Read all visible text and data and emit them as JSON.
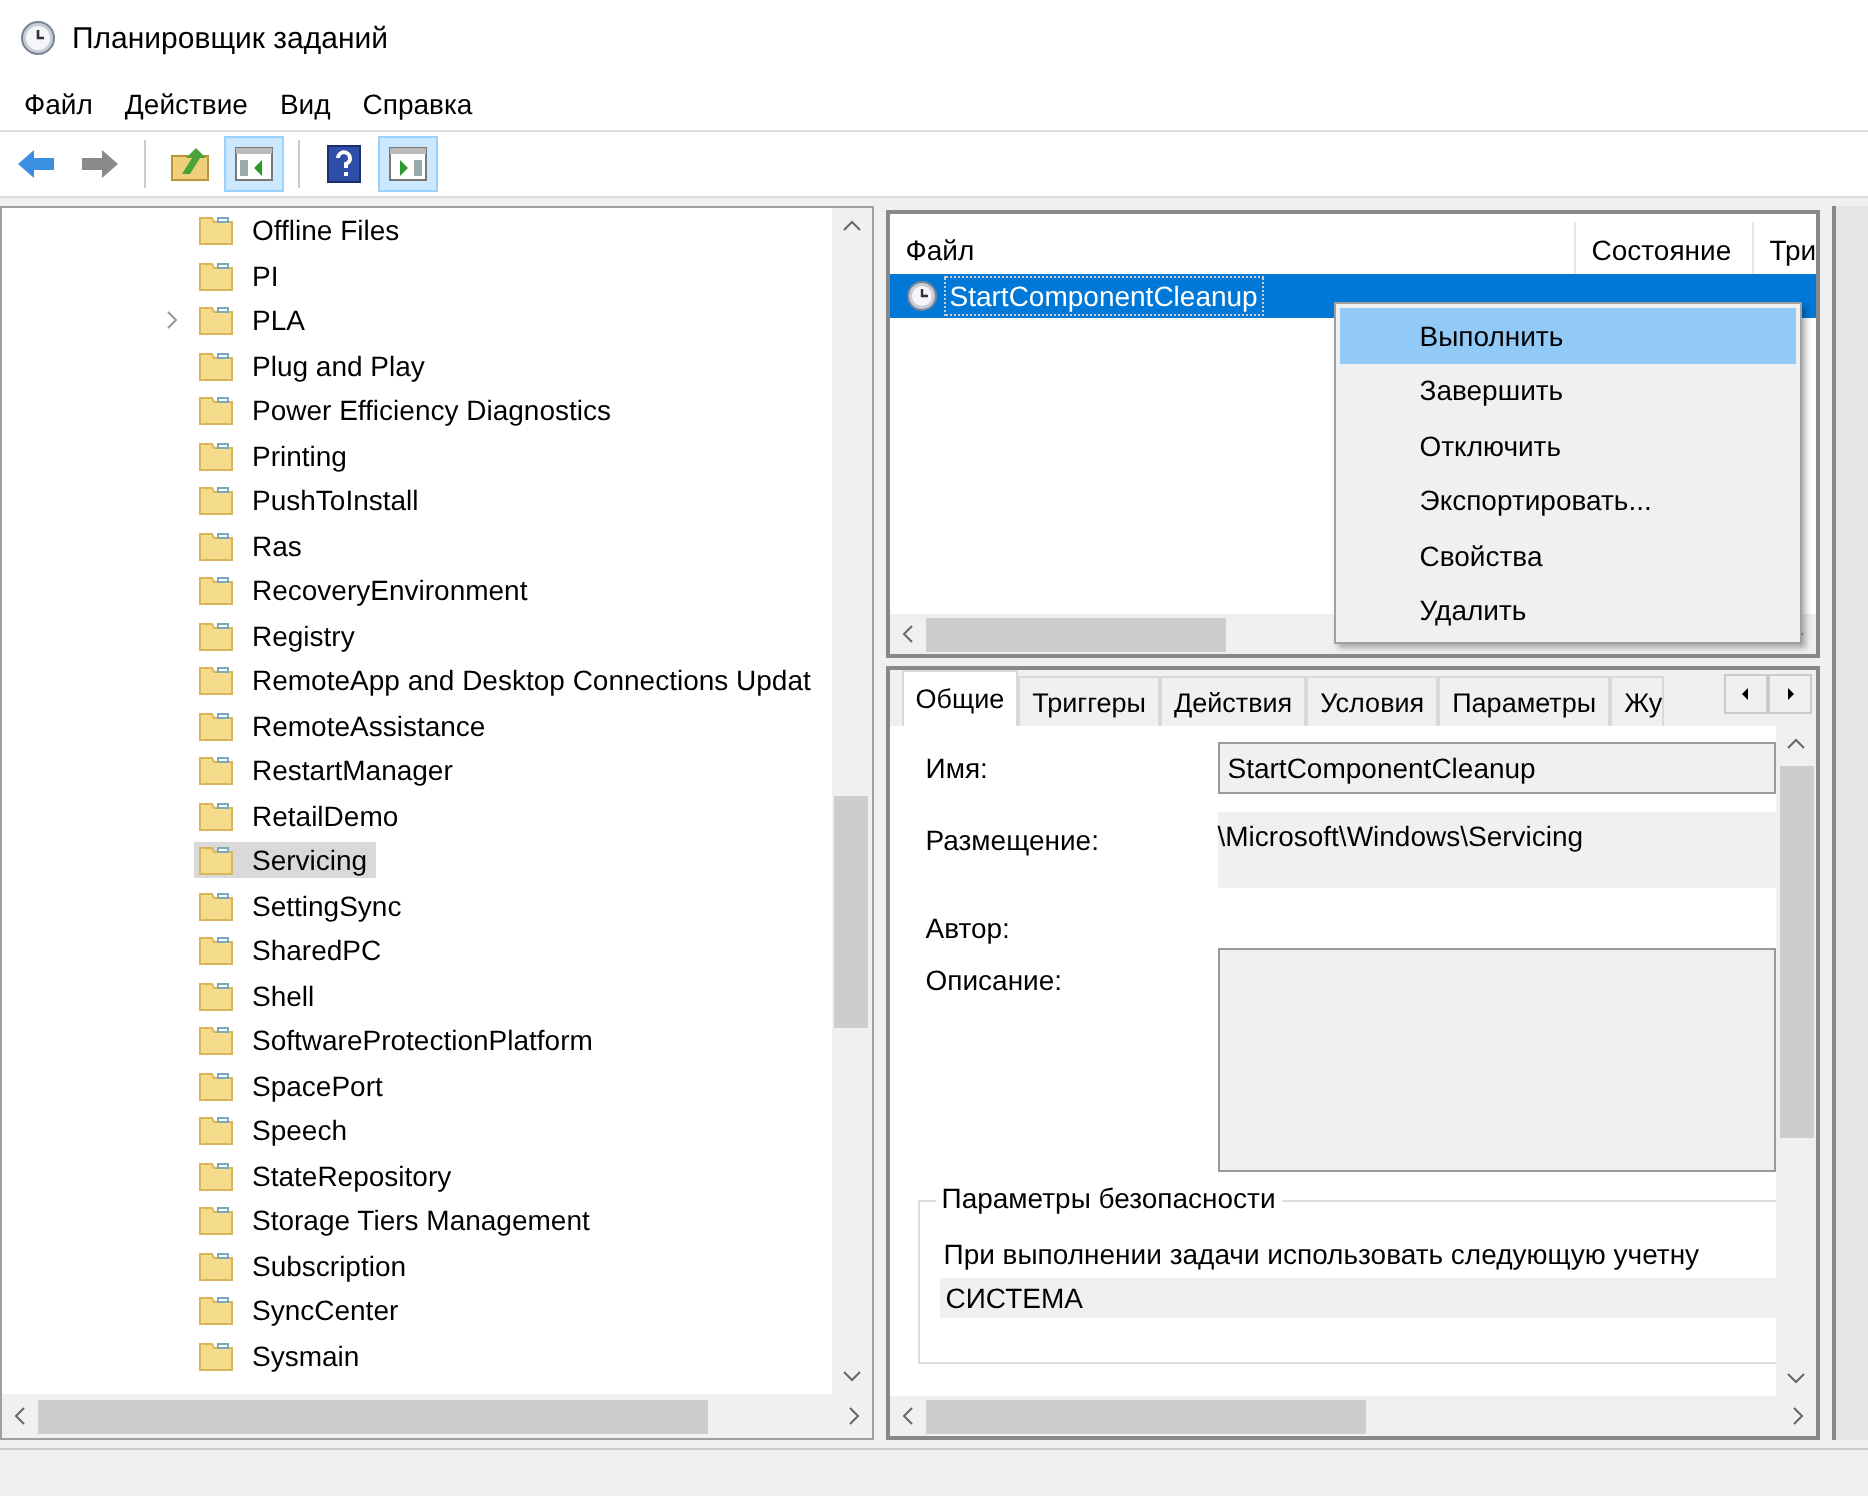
{
  "window": {
    "title": "Планировщик заданий"
  },
  "menu": [
    "Файл",
    "Действие",
    "Вид",
    "Справка"
  ],
  "toolbar": [
    {
      "kind": "back",
      "pressed": false
    },
    {
      "kind": "forward",
      "pressed": false
    },
    {
      "kind": "up",
      "pressed": false
    },
    {
      "kind": "tree",
      "pressed": true
    },
    {
      "kind": "help",
      "pressed": false
    },
    {
      "kind": "actions",
      "pressed": true
    }
  ],
  "tree": {
    "items": [
      {
        "label": "Offline Files",
        "expandable": false,
        "selected": false
      },
      {
        "label": "PI",
        "expandable": false,
        "selected": false
      },
      {
        "label": "PLA",
        "expandable": true,
        "selected": false
      },
      {
        "label": "Plug and Play",
        "expandable": false,
        "selected": false
      },
      {
        "label": "Power Efficiency Diagnostics",
        "expandable": false,
        "selected": false
      },
      {
        "label": "Printing",
        "expandable": false,
        "selected": false
      },
      {
        "label": "PushToInstall",
        "expandable": false,
        "selected": false
      },
      {
        "label": "Ras",
        "expandable": false,
        "selected": false
      },
      {
        "label": "RecoveryEnvironment",
        "expandable": false,
        "selected": false
      },
      {
        "label": "Registry",
        "expandable": false,
        "selected": false
      },
      {
        "label": "RemoteApp and Desktop Connections Updat",
        "expandable": false,
        "selected": false
      },
      {
        "label": "RemoteAssistance",
        "expandable": false,
        "selected": false
      },
      {
        "label": "RestartManager",
        "expandable": false,
        "selected": false
      },
      {
        "label": "RetailDemo",
        "expandable": false,
        "selected": false
      },
      {
        "label": "Servicing",
        "expandable": false,
        "selected": true
      },
      {
        "label": "SettingSync",
        "expandable": false,
        "selected": false
      },
      {
        "label": "SharedPC",
        "expandable": false,
        "selected": false
      },
      {
        "label": "Shell",
        "expandable": false,
        "selected": false
      },
      {
        "label": "SoftwareProtectionPlatform",
        "expandable": false,
        "selected": false
      },
      {
        "label": "SpacePort",
        "expandable": false,
        "selected": false
      },
      {
        "label": "Speech",
        "expandable": false,
        "selected": false
      },
      {
        "label": "StateRepository",
        "expandable": false,
        "selected": false
      },
      {
        "label": "Storage Tiers Management",
        "expandable": false,
        "selected": false
      },
      {
        "label": "Subscription",
        "expandable": false,
        "selected": false
      },
      {
        "label": "SyncCenter",
        "expandable": false,
        "selected": false
      },
      {
        "label": "Sysmain",
        "expandable": false,
        "selected": false
      }
    ]
  },
  "task_list": {
    "columns": [
      "Файл",
      "Состояние",
      "Три"
    ],
    "rows": [
      {
        "name": "StartComponentCleanup",
        "selected": true
      }
    ]
  },
  "context_menu": [
    {
      "label": "Выполнить",
      "selected": true
    },
    {
      "label": "Завершить",
      "selected": false
    },
    {
      "label": "Отключить",
      "selected": false
    },
    {
      "label": "Экспортировать...",
      "selected": false
    },
    {
      "label": "Свойства",
      "selected": false
    },
    {
      "label": "Удалить",
      "selected": false
    }
  ],
  "details": {
    "tabs": [
      {
        "label": "Общие",
        "selected": true
      },
      {
        "label": "Триггеры",
        "selected": false
      },
      {
        "label": "Действия",
        "selected": false
      },
      {
        "label": "Условия",
        "selected": false
      },
      {
        "label": "Параметры",
        "selected": false
      },
      {
        "label": "Жу",
        "selected": false
      }
    ],
    "name_label": "Имя:",
    "name_value": "StartComponentCleanup",
    "location_label": "Размещение:",
    "location_value": "\\Microsoft\\Windows\\Servicing",
    "author_label": "Автор:",
    "description_label": "Описание:",
    "security": {
      "title": "Параметры безопасности",
      "text": "При выполнении задачи использовать следующую учетну",
      "account": "СИСТЕМА"
    }
  }
}
